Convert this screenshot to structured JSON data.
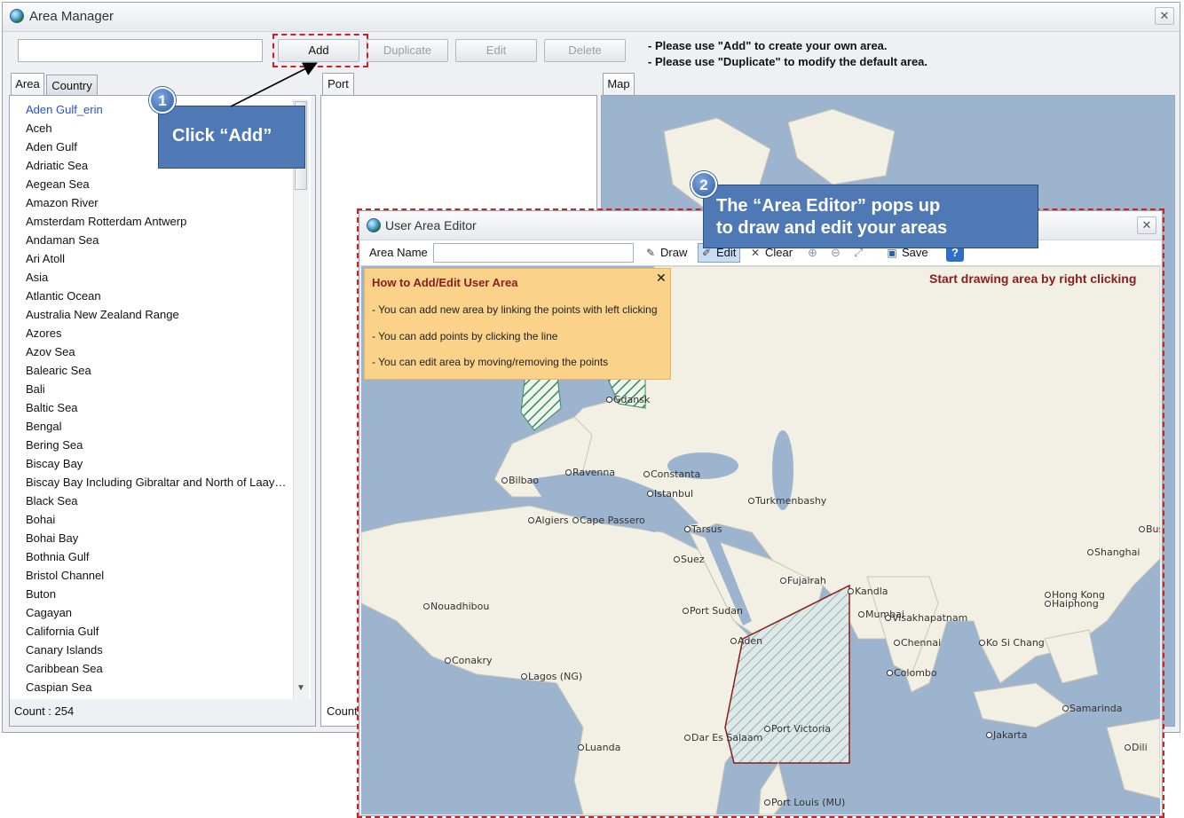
{
  "main_window": {
    "title": "Area Manager",
    "close_glyph": "✕",
    "search_value": "",
    "buttons": {
      "add": "Add",
      "duplicate": "Duplicate",
      "edit": "Edit",
      "delete": "Delete"
    },
    "notes": [
      "- Please use \"Add\" to create your own area.",
      "- Please use \"Duplicate\" to modify the default area."
    ],
    "tabs": {
      "area": "Area",
      "country": "Country",
      "port": "Port",
      "map": "Map"
    },
    "area_list": [
      "Aden Gulf_erin",
      "Aceh",
      "Aden Gulf",
      "Adriatic Sea",
      "Aegean Sea",
      "Amazon River",
      "Amsterdam Rotterdam Antwerp",
      "Andaman Sea",
      "Ari Atoll",
      "Asia",
      "Atlantic Ocean",
      "Australia New Zealand Range",
      "Azores",
      "Azov Sea",
      "Balearic Sea",
      "Bali",
      "Baltic Sea",
      "Bengal",
      "Bering Sea",
      "Biscay Bay",
      "Biscay Bay Including Gibraltar and North of Laay…",
      "Black Sea",
      "Bohai",
      "Bohai Bay",
      "Bothnia Gulf",
      "Bristol Channel",
      "Buton",
      "Cagayan",
      "California Gulf",
      "Canary Islands",
      "Caribbean Sea",
      "Caspian Sea"
    ],
    "count_label": "Count : 254",
    "port_count_label": "Count"
  },
  "callouts": {
    "step1_number": "1",
    "step1_text": "Click “Add”",
    "step2_number": "2",
    "step2_line1": "The “Area Editor” pops up",
    "step2_line2": "to draw and edit your areas"
  },
  "editor": {
    "title": "User Area Editor",
    "close_glyph": "✕",
    "area_name_label": "Area Name",
    "area_name_value": "",
    "toolbar": {
      "draw": "Draw",
      "edit": "Edit",
      "clear": "Clear",
      "save": "Save"
    },
    "hint": "Start drawing area by right clicking",
    "howto": {
      "title": "How to Add/Edit User Area",
      "close_glyph": "✕",
      "lines": [
        "- You can add new area by linking the points with left clicking",
        "- You can add points by clicking the line",
        "- You can edit area by moving/removing the points"
      ]
    },
    "map_labels": [
      "Gdansk",
      "Ravenna",
      "Constanta",
      "Bilbao",
      "Istanbul",
      "Turkmenbashy",
      "Algiers",
      "Cape Passero",
      "Tarsus",
      "Busan",
      "Shanghai",
      "Suez",
      "Fujairah",
      "Kandla",
      "Hong Kong",
      "Haiphong",
      "Nouadhibou",
      "Port Sudan",
      "Mumbai",
      "Visakhapatnam",
      "Aden",
      "Chennai",
      "Ko Si Chang",
      "Conakry",
      "Colombo",
      "Lagos (NG)",
      "Samarinda",
      "Port Victoria",
      "Jakarta",
      "Dar Es Salaam",
      "Luanda",
      "Dili",
      "Port Louis (MU)"
    ]
  },
  "colors": {
    "accent": "#4f79b4",
    "highlight": "#d21f1f",
    "sea": "#9db4cf",
    "land": "#f2efe4",
    "howto_bg": "#fbd28a"
  }
}
